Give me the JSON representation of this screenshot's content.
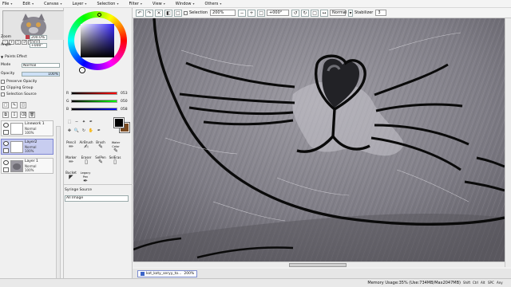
{
  "menu": [
    "File",
    "Edit",
    "Canvas",
    "Layer",
    "Selection",
    "Filter",
    "View",
    "Window",
    "Others"
  ],
  "navigator": {
    "zoom_label": "Zoom",
    "zoom_value": "200.0%",
    "angle_label": "Angle",
    "angle_value": "+000°"
  },
  "paint_effect": {
    "title": "Paints Effect",
    "mode_label": "Mode",
    "mode_value": "Normal",
    "opacity_label": "Opacity",
    "opacity_value": "100%",
    "opacity_fraction": 1.0,
    "preserve_opacity": "Preserve Opacity",
    "clipping_group": "Clipping Group",
    "selection_source": "Selection Source"
  },
  "layers": [
    {
      "name": "Linework 1",
      "mode": "Normal",
      "opacity": "100%",
      "selected": false
    },
    {
      "name": "Layer2",
      "mode": "Normal",
      "opacity": "100%",
      "selected": true
    },
    {
      "name": "Layer 1",
      "mode": "Normal",
      "opacity": "100%",
      "selected": false
    }
  ],
  "color": {
    "r_label": "R",
    "r_value": "053",
    "g_label": "G",
    "g_value": "050",
    "b_label": "B",
    "b_value": "058",
    "primary": "#000000",
    "secondary": "#7a4a20"
  },
  "tools": [
    {
      "label": "Pencil",
      "icon": "pencil-icon"
    },
    {
      "label": "AirBrush",
      "icon": "airbrush-icon"
    },
    {
      "label": "Brush",
      "icon": "brush-icon"
    },
    {
      "label": "Water Color",
      "icon": "watercolor-icon"
    },
    {
      "label": "Marker",
      "icon": "marker-icon"
    },
    {
      "label": "Eraser",
      "icon": "eraser-icon"
    },
    {
      "label": "SelPen",
      "icon": "selpen-icon"
    },
    {
      "label": "SelEras",
      "icon": "seleraser-icon"
    },
    {
      "label": "Bucket",
      "icon": "bucket-icon"
    },
    {
      "label": "Legacy Pen",
      "icon": "legacy-pen-icon"
    }
  ],
  "syringe": {
    "label": "Syringe Source",
    "value": "All Image"
  },
  "toolbar": {
    "selection_label": "Selection",
    "zoom_value": "200%",
    "angle_value": "+000°",
    "mode_value": "Normal",
    "stabilizer_label": "Stabilizer",
    "stabilizer_value": "3"
  },
  "document_tab": {
    "name": "kot_koty_seryy_to...",
    "zoom": "200%"
  },
  "status": {
    "memory": "Memory Usage:35% (Use:734MB/Max2047MB)",
    "indicators": [
      "Shift",
      "Ctrl",
      "Alt",
      "SPC",
      "Any"
    ]
  }
}
